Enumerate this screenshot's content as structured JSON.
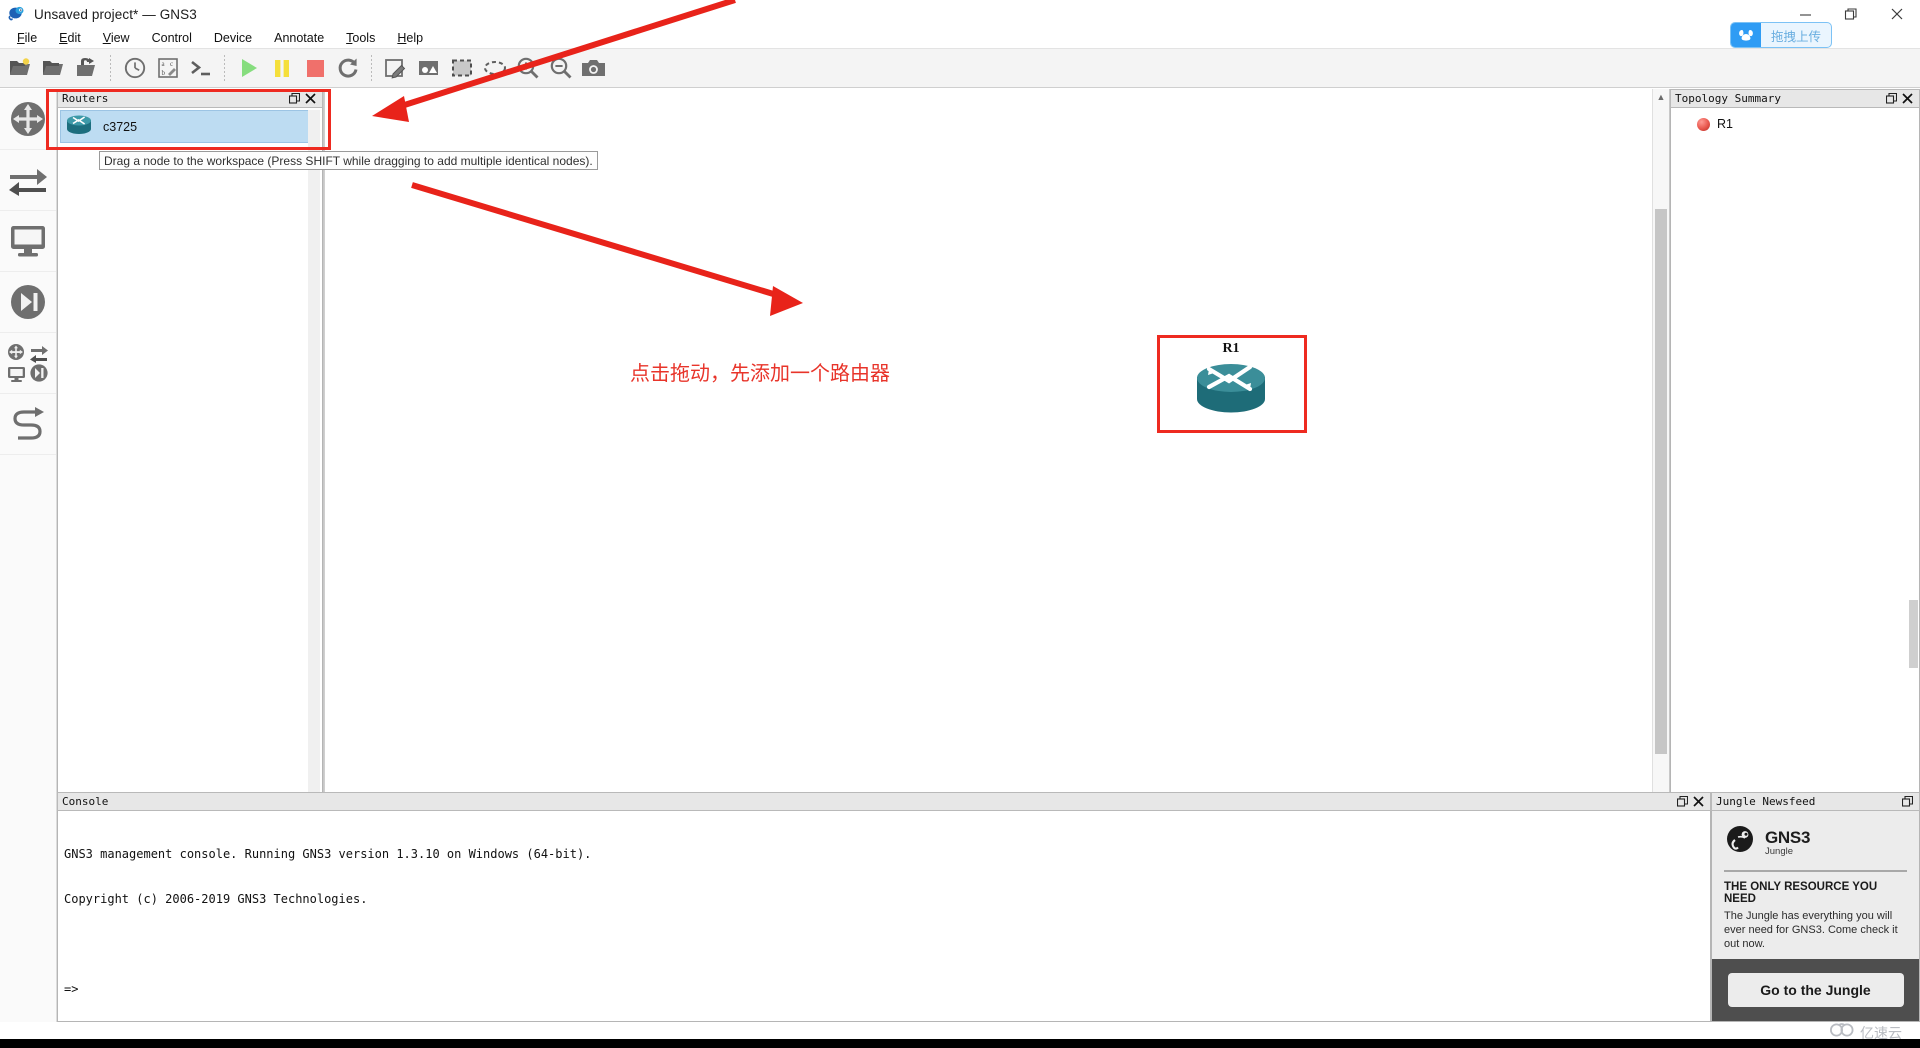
{
  "window": {
    "title": "Unsaved project* — GNS3",
    "app_icon": "gns3-chameleon-icon",
    "controls": [
      {
        "name": "minimize-button",
        "glyph": "—"
      },
      {
        "name": "maximize-button",
        "glyph": "❐"
      },
      {
        "name": "close-button",
        "glyph": "✕"
      }
    ]
  },
  "menubar": {
    "items": [
      {
        "label": "File",
        "accel": "F"
      },
      {
        "label": "Edit",
        "accel": "E"
      },
      {
        "label": "View",
        "accel": "V"
      },
      {
        "label": "Control",
        "accel": "C"
      },
      {
        "label": "Device",
        "accel": "D"
      },
      {
        "label": "Annotate",
        "accel": "A"
      },
      {
        "label": "Tools",
        "accel": "T"
      },
      {
        "label": "Help",
        "accel": "H"
      }
    ]
  },
  "baidu_upload": {
    "label": "拖拽上传",
    "icon": "baidu-netdisk-icon",
    "accent": "#2f9cf4"
  },
  "toolbar": {
    "groups": [
      [
        {
          "name": "new-project-button",
          "icon": "new-project-icon",
          "tip": "New project"
        },
        {
          "name": "open-project-button",
          "icon": "open-folder-icon",
          "tip": "Open project"
        },
        {
          "name": "save-project-as-button",
          "icon": "save-as-icon",
          "tip": "Save project as"
        }
      ],
      [
        {
          "name": "snapshot-button",
          "icon": "clock-icon",
          "tip": "Snapshots"
        },
        {
          "name": "show-hide-names-button",
          "icon": "abc-icon",
          "tip": "Show/hide interface labels"
        },
        {
          "name": "console-all-button",
          "icon": "terminal-prompt-icon",
          "tip": "Console to all devices"
        }
      ],
      [
        {
          "name": "start-all-button",
          "icon": "play-icon",
          "tip": "Start all devices",
          "color": "#86dd7e"
        },
        {
          "name": "pause-all-button",
          "icon": "pause-icon",
          "tip": "Suspend all devices",
          "color": "#f5df3a"
        },
        {
          "name": "stop-all-button",
          "icon": "stop-icon",
          "tip": "Stop all devices",
          "color": "#f0706b"
        },
        {
          "name": "reload-all-button",
          "icon": "reload-icon",
          "tip": "Reload all devices"
        }
      ],
      [
        {
          "name": "add-note-button",
          "icon": "note-pencil-icon",
          "tip": "Add a note"
        },
        {
          "name": "insert-image-button",
          "icon": "image-icon",
          "tip": "Insert a picture"
        },
        {
          "name": "draw-rectangle-button",
          "icon": "rectangle-dashed-icon",
          "tip": "Draw a rectangle"
        },
        {
          "name": "draw-ellipse-button",
          "icon": "ellipse-dashed-icon",
          "tip": "Draw an ellipse"
        },
        {
          "name": "zoom-in-button",
          "icon": "zoom-in-icon",
          "tip": "Zoom in"
        },
        {
          "name": "zoom-out-button",
          "icon": "zoom-out-icon",
          "tip": "Zoom out"
        },
        {
          "name": "screenshot-button",
          "icon": "camera-icon",
          "tip": "Take a screenshot"
        }
      ]
    ]
  },
  "device_rail": {
    "items": [
      {
        "name": "rail-routers",
        "icon": "router-icon",
        "label": "Routers",
        "selected": true
      },
      {
        "name": "rail-switches",
        "icon": "switch-arrows-icon",
        "label": "Switches"
      },
      {
        "name": "rail-end-devices",
        "icon": "monitor-icon",
        "label": "End devices"
      },
      {
        "name": "rail-security-devices",
        "icon": "firewall-circle-icon",
        "label": "Security devices"
      },
      {
        "name": "rail-all-devices",
        "icon": "all-devices-grid-icon",
        "label": "All devices"
      },
      {
        "name": "rail-add-link",
        "icon": "add-link-cable-icon",
        "label": "Add a link"
      }
    ]
  },
  "routers_dock": {
    "title": "Routers",
    "controls": [
      {
        "name": "float-button",
        "glyph": "float-icon"
      },
      {
        "name": "close-button",
        "glyph": "close-icon"
      }
    ],
    "items": [
      {
        "name": "router-template-c3725",
        "label": "c3725",
        "icon": "router-icon",
        "selected": true
      }
    ]
  },
  "tooltip": {
    "text": "Drag a node to the workspace (Press SHIFT while dragging to add multiple identical nodes)."
  },
  "canvas": {
    "annotation_cn": "点击拖动，先添加一个路由器",
    "nodes": [
      {
        "name": "canvas-node-r1",
        "label": "R1",
        "icon": "cisco-router-icon",
        "highlighted": true
      }
    ],
    "highlight_color": "#ee2a20",
    "scroll": {
      "v_arrow_up": "▲",
      "v_arrow_down": "▼",
      "h_arrow_left": "❮",
      "h_arrow_right": "❯"
    }
  },
  "topology_summary": {
    "title": "Topology Summary",
    "controls": [
      {
        "name": "float-button",
        "glyph": "float-icon"
      },
      {
        "name": "close-button",
        "glyph": "close-icon"
      }
    ],
    "rows": [
      {
        "name": "topology-node-r1",
        "label": "R1",
        "status": "stopped",
        "status_color": "#e8564c"
      }
    ]
  },
  "console": {
    "title": "Console",
    "controls": [
      {
        "name": "float-button",
        "glyph": "float-icon"
      },
      {
        "name": "close-button",
        "glyph": "close-icon"
      }
    ],
    "lines": [
      "GNS3 management console. Running GNS3 version 1.3.10 on Windows (64-bit).",
      "Copyright (c) 2006-2019 GNS3 Technologies.",
      "",
      "=>"
    ]
  },
  "newsfeed": {
    "title": "Jungle Newsfeed",
    "controls": [
      {
        "name": "float-button",
        "glyph": "float-icon"
      }
    ],
    "logo_primary": "GNS3",
    "logo_secondary": "Jungle",
    "headline": "THE ONLY RESOURCE YOU NEED",
    "body": "The Jungle has everything you will ever need for GNS3. Come check it out now.",
    "cta_label": "Go to the Jungle"
  },
  "watermark": {
    "label": "亿速云",
    "icon": "yisu-cloud-icon"
  }
}
